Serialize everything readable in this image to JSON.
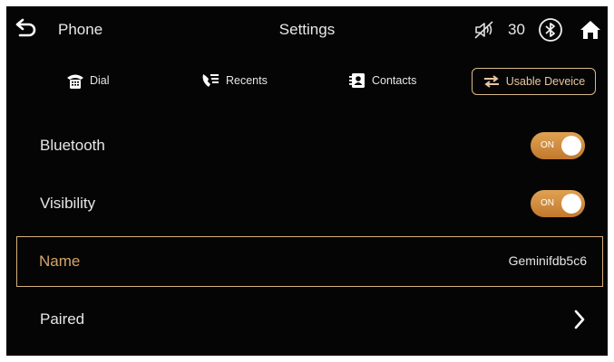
{
  "topbar": {
    "back_icon": "back-arrow-icon",
    "app_title": "Phone",
    "page_title": "Settings",
    "volume_icon": "volume-muted-icon",
    "volume_value": "30",
    "bluetooth_icon": "bluetooth-icon",
    "home_icon": "home-icon"
  },
  "tabs": [
    {
      "label": "Dial",
      "icon": "dialpad-phone-icon"
    },
    {
      "label": "Recents",
      "icon": "recents-phone-icon"
    },
    {
      "label": "Contacts",
      "icon": "contacts-card-icon"
    },
    {
      "label": "Usable Deveice",
      "icon": "swap-arrows-icon",
      "active": true
    }
  ],
  "settings": {
    "bluetooth": {
      "label": "Bluetooth",
      "state": "ON"
    },
    "visibility": {
      "label": "Visibility",
      "state": "ON"
    },
    "name": {
      "label": "Name",
      "value": "Geminifdb5c6"
    },
    "paired": {
      "label": "Paired",
      "icon": "chevron-right-icon"
    }
  },
  "colors": {
    "accent": "#d9a35e",
    "toggle_on": "#d58f42",
    "background": "#050505",
    "text": "#e6e6e6"
  }
}
